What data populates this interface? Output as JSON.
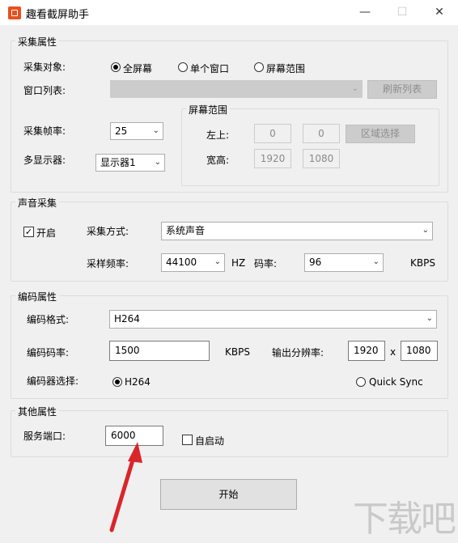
{
  "window": {
    "title": "趣看截屏助手",
    "minimize": "—",
    "maximize": "☐",
    "close": "✕"
  },
  "capture": {
    "group_title": "采集属性",
    "target_label": "采集对象:",
    "target_options": [
      "全屏幕",
      "单个窗口",
      "屏幕范围"
    ],
    "target_selected": "全屏幕",
    "window_list_label": "窗口列表:",
    "window_list_value": "",
    "refresh_button": "刷新列表",
    "fps_label": "采集帧率:",
    "fps_value": "25",
    "monitor_label": "多显示器:",
    "monitor_value": "显示器1",
    "range": {
      "group_title": "屏幕范围",
      "top_left_label": "左上:",
      "x": "0",
      "y": "0",
      "select_button": "区域选择",
      "size_label": "宽高:",
      "width": "1920",
      "height": "1080"
    }
  },
  "audio": {
    "group_title": "声音采集",
    "enable_label": "开启",
    "enabled": true,
    "mode_label": "采集方式:",
    "mode_value": "系统声音",
    "rate_label": "采样频率:",
    "rate_value": "44100",
    "rate_unit": "HZ",
    "bitrate_label": "码率:",
    "bitrate_value": "96",
    "bitrate_unit": "KBPS"
  },
  "encode": {
    "group_title": "编码属性",
    "format_label": "编码格式:",
    "format_value": "H264",
    "bitrate_label": "编码码率:",
    "bitrate_value": "1500",
    "bitrate_unit": "KBPS",
    "resolution_label": "输出分辨率:",
    "res_width": "1920",
    "res_sep": "x",
    "res_height": "1080",
    "encoder_label": "编码器选择:",
    "encoder_options": [
      "H264",
      "Quick Sync"
    ],
    "encoder_selected": "H264"
  },
  "other": {
    "group_title": "其他属性",
    "port_label": "服务端口:",
    "port_value": "6000",
    "autostart_label": "自启动",
    "autostart": false
  },
  "start_button": "开始",
  "colors": {
    "annotation_arrow": "#d9262a",
    "app_icon": "#e8501d"
  }
}
